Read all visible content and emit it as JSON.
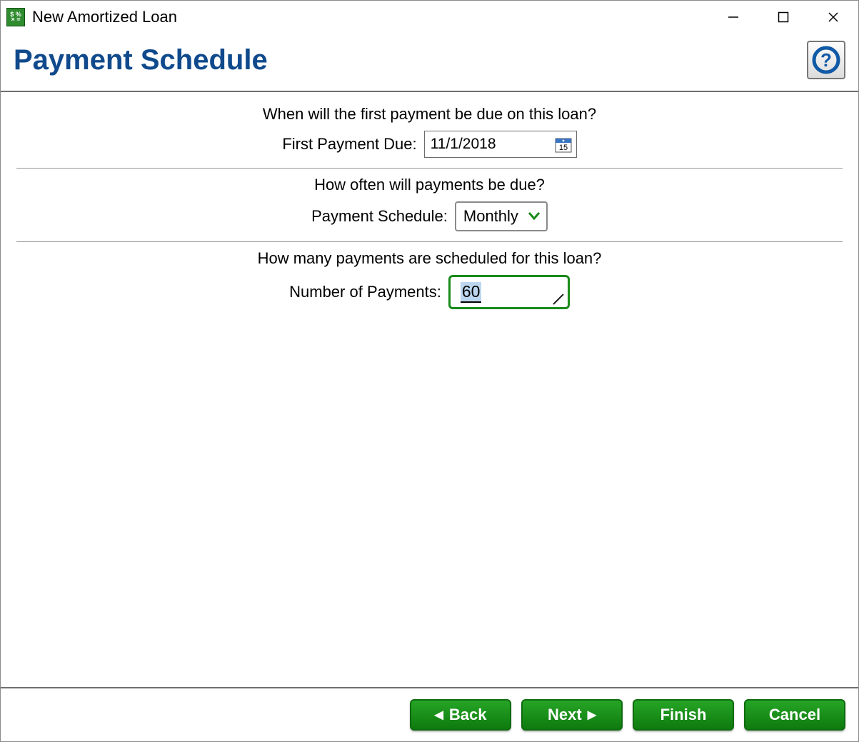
{
  "window": {
    "title": "New Amortized Loan"
  },
  "header": {
    "title": "Payment Schedule"
  },
  "sections": {
    "first_payment": {
      "question": "When will the first payment be due on this loan?",
      "label": "First Payment Due:",
      "value": "11/1/2018",
      "calendar_icon_day": "15"
    },
    "schedule": {
      "question": "How often will payments be due?",
      "label": "Payment Schedule:",
      "value": "Monthly"
    },
    "num_payments": {
      "question": "How many payments are scheduled for this loan?",
      "label": "Number of Payments:",
      "value": "60"
    }
  },
  "footer": {
    "back": "Back",
    "next": "Next",
    "finish": "Finish",
    "cancel": "Cancel"
  }
}
